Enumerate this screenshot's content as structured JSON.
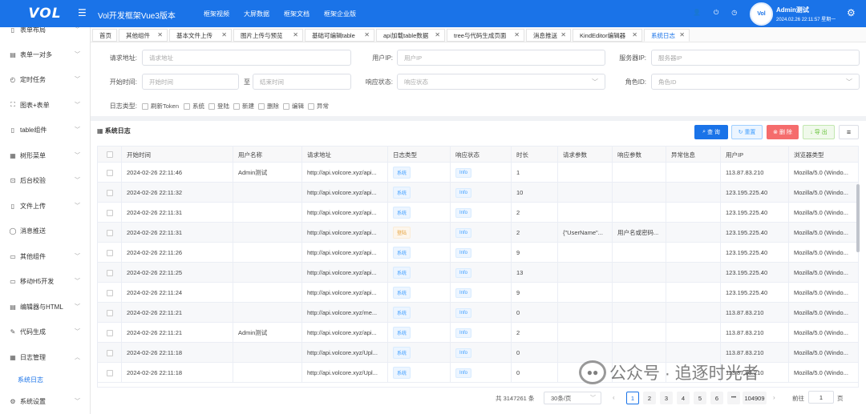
{
  "header": {
    "logo": "VOL",
    "app_title": "Vol开发框架Vue3版本",
    "nav": [
      "框架视频",
      "大屏数据",
      "框架文档",
      "框架企业版"
    ],
    "avatar_text": "Vol",
    "user_name": "Admin测试",
    "user_time": "2024.02.26 22:11:57 星期一",
    "brand_color": "#1a73e8"
  },
  "sidebar": {
    "items": [
      {
        "label": "表单布局",
        "icon": "document-icon"
      },
      {
        "label": "表单一对多",
        "icon": "list-icon"
      },
      {
        "label": "定时任务",
        "icon": "alarm-icon"
      },
      {
        "label": "图表+表单",
        "icon": "fullscreen-icon"
      },
      {
        "label": "table组件",
        "icon": "table-icon"
      },
      {
        "label": "树形菜单",
        "icon": "tree-icon"
      },
      {
        "label": "后台校验",
        "icon": "check-icon"
      },
      {
        "label": "文件上传",
        "icon": "file-icon"
      },
      {
        "label": "消息推送",
        "icon": "message-icon"
      },
      {
        "label": "其他组件",
        "icon": "component-icon"
      },
      {
        "label": "移动H5开发",
        "icon": "mobile-icon"
      },
      {
        "label": "编辑器与HTML",
        "icon": "editor-icon"
      },
      {
        "label": "代码生成",
        "icon": "code-icon"
      },
      {
        "label": "日志管理",
        "icon": "calendar-icon"
      },
      {
        "label": "系统设置",
        "icon": "settings-icon"
      }
    ],
    "active_sub": "系统日志"
  },
  "tabs": [
    {
      "label": "首页"
    },
    {
      "label": "其他组件"
    },
    {
      "label": "基本文件上传"
    },
    {
      "label": "图片上传与预览"
    },
    {
      "label": "基础可编辑table"
    },
    {
      "label": "api加载table数据"
    },
    {
      "label": "tree与代码生成页面"
    },
    {
      "label": "消息推送"
    },
    {
      "label": "KindEditor编辑器"
    },
    {
      "label": "系统日志"
    }
  ],
  "filters": {
    "request_url_label": "请求地址:",
    "request_url_placeholder": "请求地址",
    "user_ip_label": "用户IP:",
    "user_ip_placeholder": "用户IP",
    "server_ip_label": "服务器IP:",
    "server_ip_placeholder": "服务器IP",
    "start_time_label": "开始时间:",
    "start_time_placeholder": "开始时间",
    "to_label": "至",
    "end_time_placeholder": "结束时间",
    "response_status_label": "响应状态:",
    "response_status_placeholder": "响应状态",
    "role_id_label": "角色ID:",
    "role_id_placeholder": "角色ID",
    "log_type_label": "日志类型:",
    "log_types": [
      "刷新Token",
      "系统",
      "登陆",
      "新建",
      "删除",
      "编辑",
      "异常"
    ]
  },
  "grid": {
    "title": "系统日志",
    "buttons": {
      "query": "查 询",
      "reset": "重置",
      "delete": "删 除",
      "export": "导 出"
    },
    "columns": [
      "开始时间",
      "用户名称",
      "请求地址",
      "日志类型",
      "响应状态",
      "时长",
      "请求参数",
      "响应参数",
      "异常信息",
      "用户IP",
      "浏览器类型"
    ],
    "rows": [
      {
        "time": "2024-02-26 22:11:46",
        "user": "Admin测试",
        "url": "http://api.volcore.xyz/api...",
        "type": "系统",
        "status": "Info",
        "dur": "1",
        "req": "",
        "resp": "",
        "err": "",
        "ip": "113.87.83.210",
        "ua": "Mozilla/5.0 (Windo..."
      },
      {
        "time": "2024-02-26 22:11:32",
        "user": "",
        "url": "http://api.volcore.xyz/api...",
        "type": "系统",
        "status": "Info",
        "dur": "10",
        "req": "",
        "resp": "",
        "err": "",
        "ip": "123.195.225.40",
        "ua": "Mozilla/5.0 (Windo..."
      },
      {
        "time": "2024-02-26 22:11:31",
        "user": "",
        "url": "http://api.volcore.xyz/api...",
        "type": "系统",
        "status": "Info",
        "dur": "2",
        "req": "",
        "resp": "",
        "err": "",
        "ip": "123.195.225.40",
        "ua": "Mozilla/5.0 (Windo..."
      },
      {
        "time": "2024-02-26 22:11:31",
        "user": "",
        "url": "http://api.volcore.xyz/api...",
        "type": "登陆",
        "status": "Info",
        "dur": "2",
        "req": "{\"UserName\"...",
        "resp": "用户名或密码...",
        "err": "",
        "ip": "123.195.225.40",
        "ua": "Mozilla/5.0 (Windo..."
      },
      {
        "time": "2024-02-26 22:11:26",
        "user": "",
        "url": "http://api.volcore.xyz/api...",
        "type": "系统",
        "status": "Info",
        "dur": "9",
        "req": "",
        "resp": "",
        "err": "",
        "ip": "123.195.225.40",
        "ua": "Mozilla/5.0 (Windo..."
      },
      {
        "time": "2024-02-26 22:11:25",
        "user": "",
        "url": "http://api.volcore.xyz/api...",
        "type": "系统",
        "status": "Info",
        "dur": "13",
        "req": "",
        "resp": "",
        "err": "",
        "ip": "123.195.225.40",
        "ua": "Mozilla/5.0 (Windo..."
      },
      {
        "time": "2024-02-26 22:11:24",
        "user": "",
        "url": "http://api.volcore.xyz/api...",
        "type": "系统",
        "status": "Info",
        "dur": "9",
        "req": "",
        "resp": "",
        "err": "",
        "ip": "123.195.225.40",
        "ua": "Mozilla/5.0 (Windo..."
      },
      {
        "time": "2024-02-26 22:11:21",
        "user": "",
        "url": "http://api.volcore.xyz/me...",
        "type": "系统",
        "status": "Info",
        "dur": "0",
        "req": "",
        "resp": "",
        "err": "",
        "ip": "113.87.83.210",
        "ua": "Mozilla/5.0 (Windo..."
      },
      {
        "time": "2024-02-26 22:11:21",
        "user": "Admin测试",
        "url": "http://api.volcore.xyz/api...",
        "type": "系统",
        "status": "Info",
        "dur": "2",
        "req": "",
        "resp": "",
        "err": "",
        "ip": "113.87.83.210",
        "ua": "Mozilla/5.0 (Windo..."
      },
      {
        "time": "2024-02-26 22:11:18",
        "user": "",
        "url": "http://api.volcore.xyz/Upl...",
        "type": "系统",
        "status": "Info",
        "dur": "0",
        "req": "",
        "resp": "",
        "err": "",
        "ip": "113.87.83.210",
        "ua": "Mozilla/5.0 (Windo..."
      },
      {
        "time": "2024-02-26 22:11:18",
        "user": "",
        "url": "http://api.volcore.xyz/Upl...",
        "type": "系统",
        "status": "Info",
        "dur": "0",
        "req": "",
        "resp": "",
        "err": "",
        "ip": "113.87.83.210",
        "ua": "Mozilla/5.0 (Windo..."
      }
    ]
  },
  "pagination": {
    "total": "共 3147261 条",
    "page_size": "30条/页",
    "pages": [
      "1",
      "2",
      "3",
      "4",
      "5",
      "6"
    ],
    "ellipsis": "•••",
    "last_page": "104909",
    "goto_label": "前往",
    "goto_value": "1",
    "goto_suffix": "页"
  },
  "watermark": "公众号 · 追逐时光者"
}
